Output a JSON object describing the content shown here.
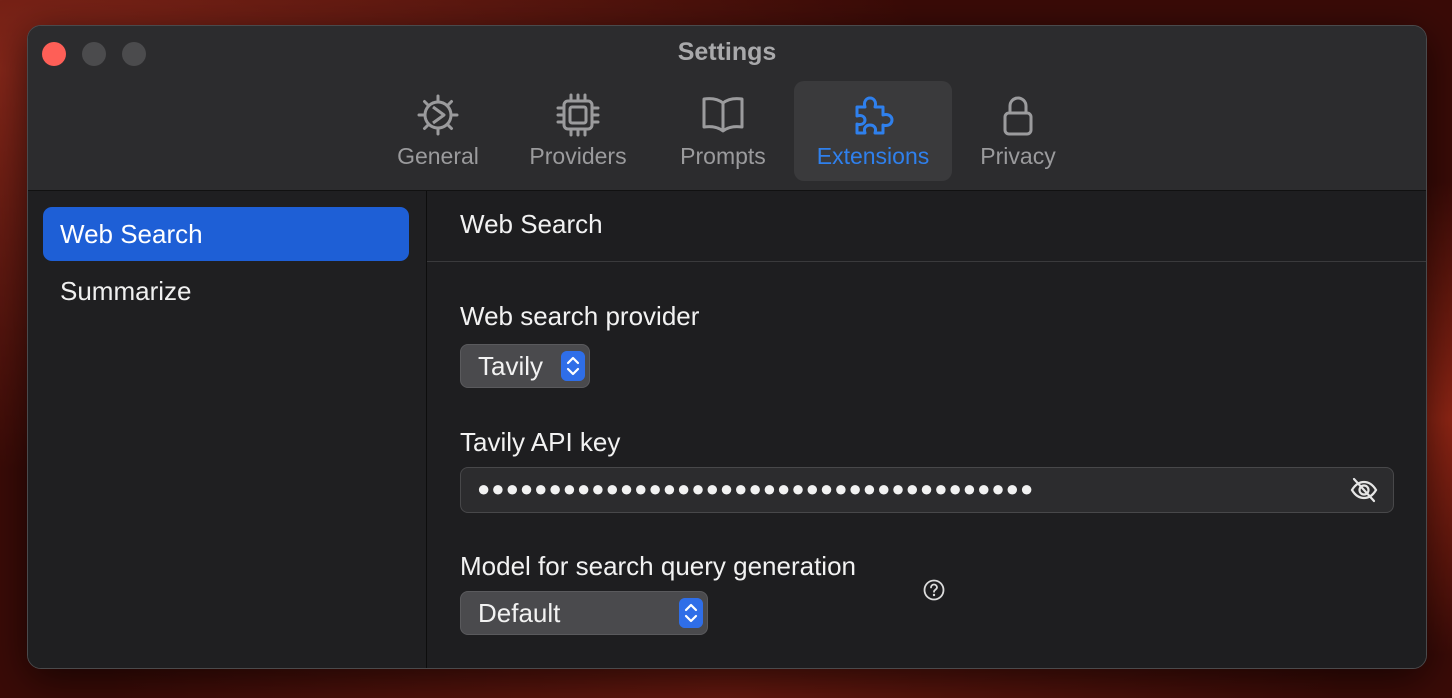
{
  "window": {
    "title": "Settings"
  },
  "tabs": [
    {
      "label": "General",
      "icon": "gear-icon"
    },
    {
      "label": "Providers",
      "icon": "cpu-chip-icon"
    },
    {
      "label": "Prompts",
      "icon": "book-icon"
    },
    {
      "label": "Extensions",
      "icon": "puzzle-icon",
      "active": true
    },
    {
      "label": "Privacy",
      "icon": "lock-icon"
    }
  ],
  "sidebar": {
    "items": [
      {
        "label": "Web Search",
        "selected": true
      },
      {
        "label": "Summarize",
        "selected": false
      }
    ]
  },
  "content": {
    "title": "Web Search",
    "provider_label": "Web search provider",
    "provider_value": "Tavily",
    "api_key_label": "Tavily API key",
    "api_key_masked": "●●●●●●●●●●●●●●●●●●●●●●●●●●●●●●●●●●●●●●●",
    "model_label": "Model for search query generation",
    "model_value": "Default"
  },
  "colors": {
    "accent": "#2f80ed",
    "selection": "#1e5fd6",
    "close": "#fe5f57"
  }
}
